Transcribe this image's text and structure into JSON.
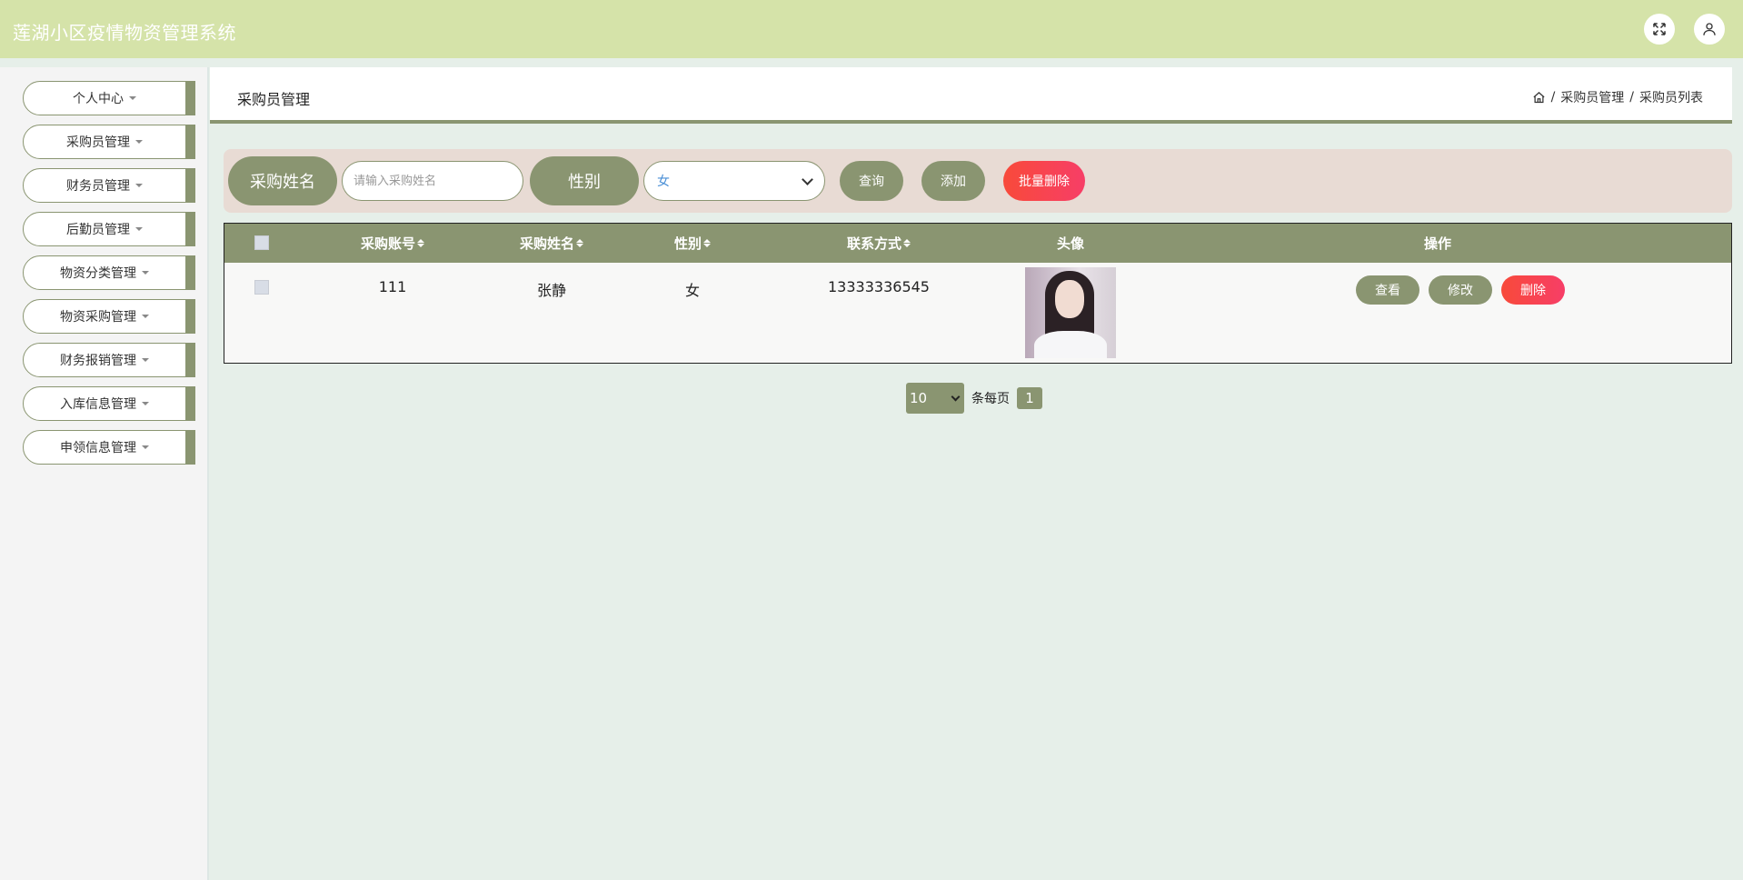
{
  "app": {
    "title": "莲湖小区疫情物资管理系统"
  },
  "sidebar": {
    "items": [
      {
        "label": "个人中心"
      },
      {
        "label": "采购员管理"
      },
      {
        "label": "财务员管理"
      },
      {
        "label": "后勤员管理"
      },
      {
        "label": "物资分类管理"
      },
      {
        "label": "物资采购管理"
      },
      {
        "label": "财务报销管理"
      },
      {
        "label": "入库信息管理"
      },
      {
        "label": "申领信息管理"
      }
    ]
  },
  "header": {
    "title": "采购员管理",
    "breadcrumb": {
      "level1": "采购员管理",
      "level2": "采购员列表",
      "separator": "/"
    }
  },
  "search": {
    "name_label": "采购姓名",
    "name_placeholder": "请输入采购姓名",
    "gender_label": "性别",
    "gender_value": "女",
    "query_btn": "查询",
    "add_btn": "添加",
    "batch_delete_btn": "批量删除"
  },
  "table": {
    "headers": {
      "account": "采购账号",
      "name": "采购姓名",
      "gender": "性别",
      "phone": "联系方式",
      "avatar": "头像",
      "actions": "操作"
    },
    "rows": [
      {
        "account": "111",
        "name": "张静",
        "gender": "女",
        "phone": "13333336545"
      }
    ],
    "actions": {
      "view": "查看",
      "edit": "修改",
      "delete": "删除"
    }
  },
  "pagination": {
    "page_size": "10",
    "per_page_label": "条每页",
    "current_page": "1"
  },
  "colors": {
    "accent": "#8a9571",
    "topbar": "#d5e3a9",
    "danger": "#f84a3a"
  }
}
